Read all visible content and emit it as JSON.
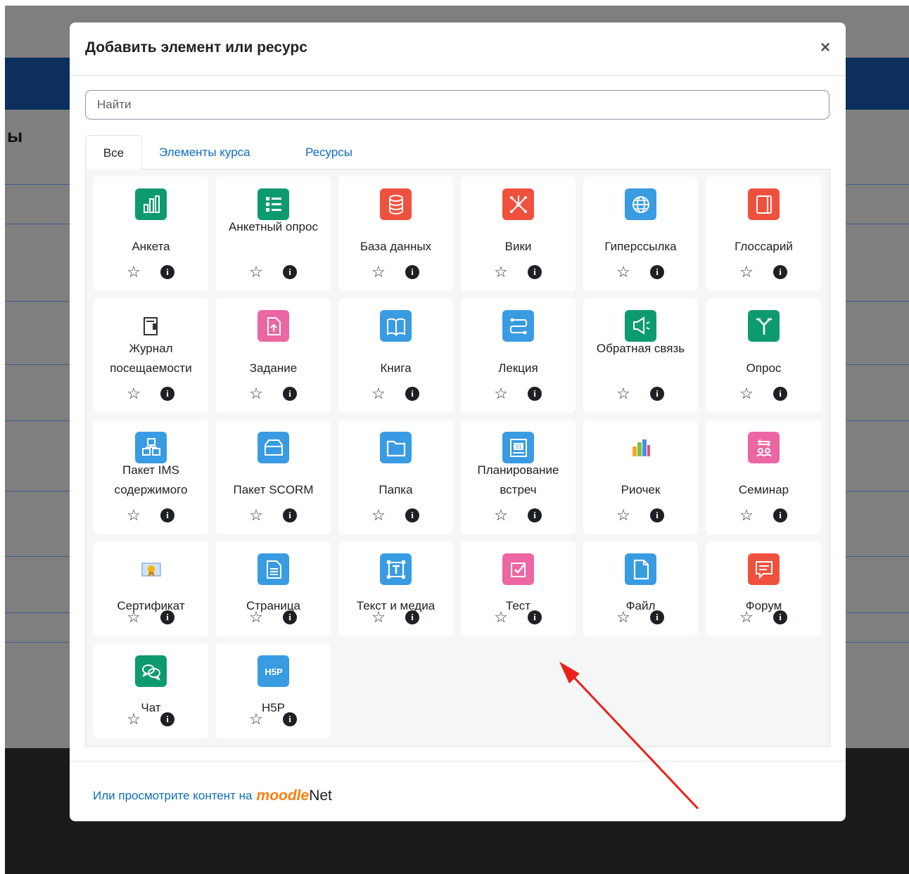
{
  "background_page": {
    "title_fragment": "ы"
  },
  "modal": {
    "title": "Добавить элемент или ресурс",
    "close_label": "×",
    "search": {
      "placeholder": "Найти",
      "value": ""
    },
    "tabs": [
      {
        "label": "Все",
        "active": true
      },
      {
        "label": "Элементы курса",
        "active": false
      },
      {
        "label": "Ресурсы",
        "active": false
      }
    ],
    "items": [
      {
        "name": "Анкета",
        "icon": "survey-icon",
        "color": "#0d9a6f"
      },
      {
        "name": "Анкетный опрос",
        "icon": "questionnaire-icon",
        "color": "#0d9a6f"
      },
      {
        "name": "База данных",
        "icon": "database-icon",
        "color": "#f0513f"
      },
      {
        "name": "Вики",
        "icon": "wiki-icon",
        "color": "#f0513f"
      },
      {
        "name": "Гиперссылка",
        "icon": "globe-icon",
        "color": "#399be2"
      },
      {
        "name": "Глоссарий",
        "icon": "glossary-icon",
        "color": "#f0513f"
      },
      {
        "name": "Журнал посещаемости",
        "icon": "attendance-icon",
        "color": "#ffffff"
      },
      {
        "name": "Задание",
        "icon": "assignment-icon",
        "color": "#eb66a2"
      },
      {
        "name": "Книга",
        "icon": "book-icon",
        "color": "#399be2"
      },
      {
        "name": "Лекция",
        "icon": "lesson-icon",
        "color": "#399be2"
      },
      {
        "name": "Обратная связь",
        "icon": "feedback-icon",
        "color": "#0d9a6f"
      },
      {
        "name": "Опрос",
        "icon": "choice-icon",
        "color": "#0d9a6f"
      },
      {
        "name": "Пакет IMS содержимого",
        "icon": "ims-package-icon",
        "color": "#399be2"
      },
      {
        "name": "Пакет SCORM",
        "icon": "scorm-icon",
        "color": "#399be2"
      },
      {
        "name": "Папка",
        "icon": "folder-icon",
        "color": "#399be2"
      },
      {
        "name": "Планирование встреч",
        "icon": "scheduler-icon",
        "color": "#399be2"
      },
      {
        "name": "Риочек",
        "icon": "bar-chart-icon",
        "color": "#ffffff"
      },
      {
        "name": "Семинар",
        "icon": "workshop-icon",
        "color": "#eb66a2"
      },
      {
        "name": "Сертификат",
        "icon": "certificate-icon",
        "color": "#ffffff"
      },
      {
        "name": "Страница",
        "icon": "page-icon",
        "color": "#399be2"
      },
      {
        "name": "Текст и медиа",
        "icon": "text-media-icon",
        "color": "#399be2"
      },
      {
        "name": "Тест",
        "icon": "quiz-icon",
        "color": "#eb66a2"
      },
      {
        "name": "Файл",
        "icon": "file-icon",
        "color": "#399be2"
      },
      {
        "name": "Форум",
        "icon": "forum-icon",
        "color": "#f0513f"
      },
      {
        "name": "Чат",
        "icon": "chat-icon",
        "color": "#0d9a6f"
      },
      {
        "name": "H5P",
        "icon": "h5p-icon",
        "color": "#399be2"
      }
    ],
    "star_glyph": "☆",
    "info_glyph": "i",
    "footer": {
      "link_text": "Или просмотрите контент на",
      "logo_moodle": "moodle",
      "logo_net": "Net"
    }
  },
  "colors": {
    "navbar": "#0d2f5f",
    "overlay": "#7f7f7f",
    "link": "#0f6cbf",
    "annotation_arrow": "#e8221b"
  }
}
